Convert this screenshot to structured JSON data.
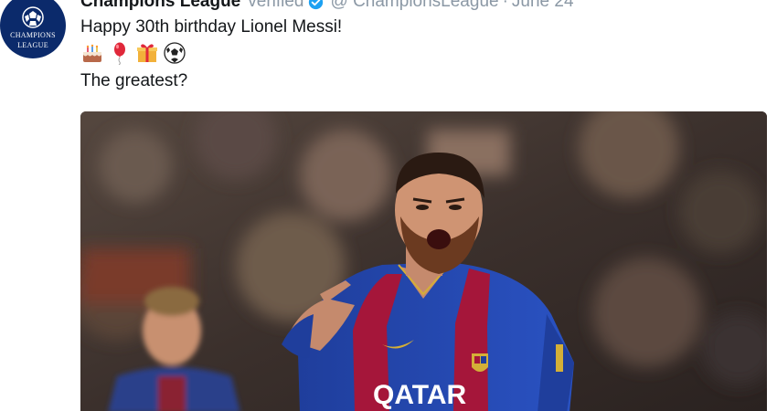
{
  "tweet": {
    "display_name": "Champions League",
    "verified_text": "verified",
    "handle": "@ ChampionsLeague",
    "separator": "·",
    "date": "June 24",
    "text_line1": "Happy 30th birthday Lionel Messi!",
    "text_line2": "The greatest?",
    "emojis": [
      "cake-icon",
      "balloon-icon",
      "gift-icon",
      "soccer-ball-icon"
    ]
  },
  "avatar": {
    "line1": "CHAMPIONS",
    "line2": "LEAGUE"
  },
  "media": {
    "shirt_sponsor": "QATAR"
  },
  "colors": {
    "text": "#14171a",
    "muted": "#8b98a5",
    "verified_blue": "#1da1f2",
    "avatar_bg": "#0b2a6b"
  }
}
